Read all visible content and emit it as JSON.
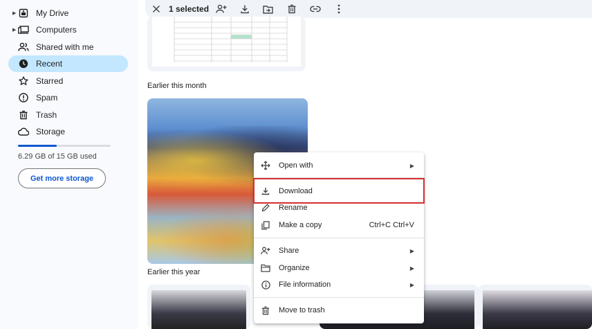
{
  "sidebar": {
    "items": [
      {
        "label": "My Drive",
        "icon": "my-drive-icon",
        "expandable": true
      },
      {
        "label": "Computers",
        "icon": "computer-icon",
        "expandable": true
      },
      {
        "label": "Shared with me",
        "icon": "people-icon",
        "expandable": false
      },
      {
        "label": "Recent",
        "icon": "clock-icon",
        "expandable": false,
        "active": true
      },
      {
        "label": "Starred",
        "icon": "star-icon",
        "expandable": false
      },
      {
        "label": "Spam",
        "icon": "spam-icon",
        "expandable": false
      },
      {
        "label": "Trash",
        "icon": "trash-icon",
        "expandable": false
      },
      {
        "label": "Storage",
        "icon": "cloud-icon",
        "expandable": false
      }
    ],
    "storage": {
      "used_text": "6.29 GB of 15 GB used",
      "used_fraction": 0.42,
      "button_label": "Get more storage"
    }
  },
  "toolbar": {
    "selected_count": "1 selected",
    "actions": [
      "close-icon",
      "share-icon",
      "download-icon",
      "move-icon",
      "trash-icon",
      "link-icon",
      "more-icon"
    ]
  },
  "sections": {
    "earlier_month": "Earlier this month",
    "earlier_year": "Earlier this year"
  },
  "context_menu": {
    "items": [
      {
        "label": "Open with",
        "icon": "open-with-icon",
        "submenu": true
      },
      {
        "label": "Download",
        "icon": "download-icon",
        "highlighted": true
      },
      {
        "label": "Rename",
        "icon": "pencil-icon"
      },
      {
        "label": "Make a copy",
        "icon": "copy-icon",
        "shortcut": "Ctrl+C Ctrl+V"
      },
      {
        "label": "Share",
        "icon": "share-icon",
        "submenu": true
      },
      {
        "label": "Organize",
        "icon": "folder-icon",
        "submenu": true
      },
      {
        "label": "File information",
        "icon": "info-icon",
        "submenu": true
      },
      {
        "label": "Move to trash",
        "icon": "trash-icon"
      }
    ]
  },
  "colors": {
    "accent": "#0b57d0",
    "active_nav": "#c2e7ff",
    "highlight_border": "#d32f2f"
  }
}
